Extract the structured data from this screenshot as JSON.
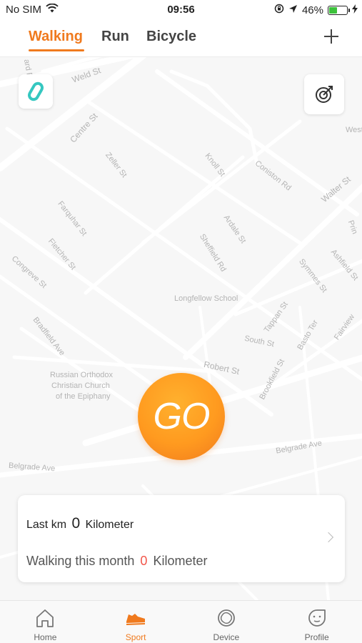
{
  "status_bar": {
    "carrier": "No SIM",
    "time": "09:56",
    "battery_percent": "46%",
    "battery_level": 0.46
  },
  "tabs": [
    {
      "label": "Walking",
      "active": true
    },
    {
      "label": "Run",
      "active": false
    },
    {
      "label": "Bicycle",
      "active": false
    }
  ],
  "map": {
    "streets": [
      "Weld St",
      "Centre St",
      "Zeller St",
      "Knoll St",
      "Coniston Rd",
      "Walter St",
      "Farquhar St",
      "Ardale St",
      "Sheffield Rd",
      "Fletcher St",
      "Symmes St",
      "Ashfield St",
      "Congreve St",
      "Tappan St",
      "Bradfield Ave",
      "South St",
      "Basto Ter",
      "Fairview",
      "Robert St",
      "Brookfield St",
      "Belgrade Ave",
      "Belgrade Ave",
      "Prin",
      "West Bury",
      "ard P"
    ],
    "landmarks": [
      "Longfellow School",
      "Russian Orthodox",
      "Christian Church",
      "of the Epiphany"
    ]
  },
  "go_button": {
    "label": "GO"
  },
  "summary": {
    "last_km_prefix": "Last km",
    "last_km_value": "0",
    "last_km_unit": "Kilometer",
    "month_prefix": "Walking this month",
    "month_value": "0",
    "month_unit": "Kilometer"
  },
  "bottom_nav": [
    {
      "label": "Home",
      "icon": "home-icon",
      "active": false
    },
    {
      "label": "Sport",
      "icon": "sneaker-icon",
      "active": true
    },
    {
      "label": "Device",
      "icon": "device-icon",
      "active": false
    },
    {
      "label": "Profile",
      "icon": "profile-icon",
      "active": false
    }
  ],
  "colors": {
    "accent": "#f07a1e",
    "go_gradient_light": "#ffb12e",
    "zero_value_red": "#f2564a",
    "map_background": "#f7f7f7",
    "band_icon": "#35c7c0"
  }
}
